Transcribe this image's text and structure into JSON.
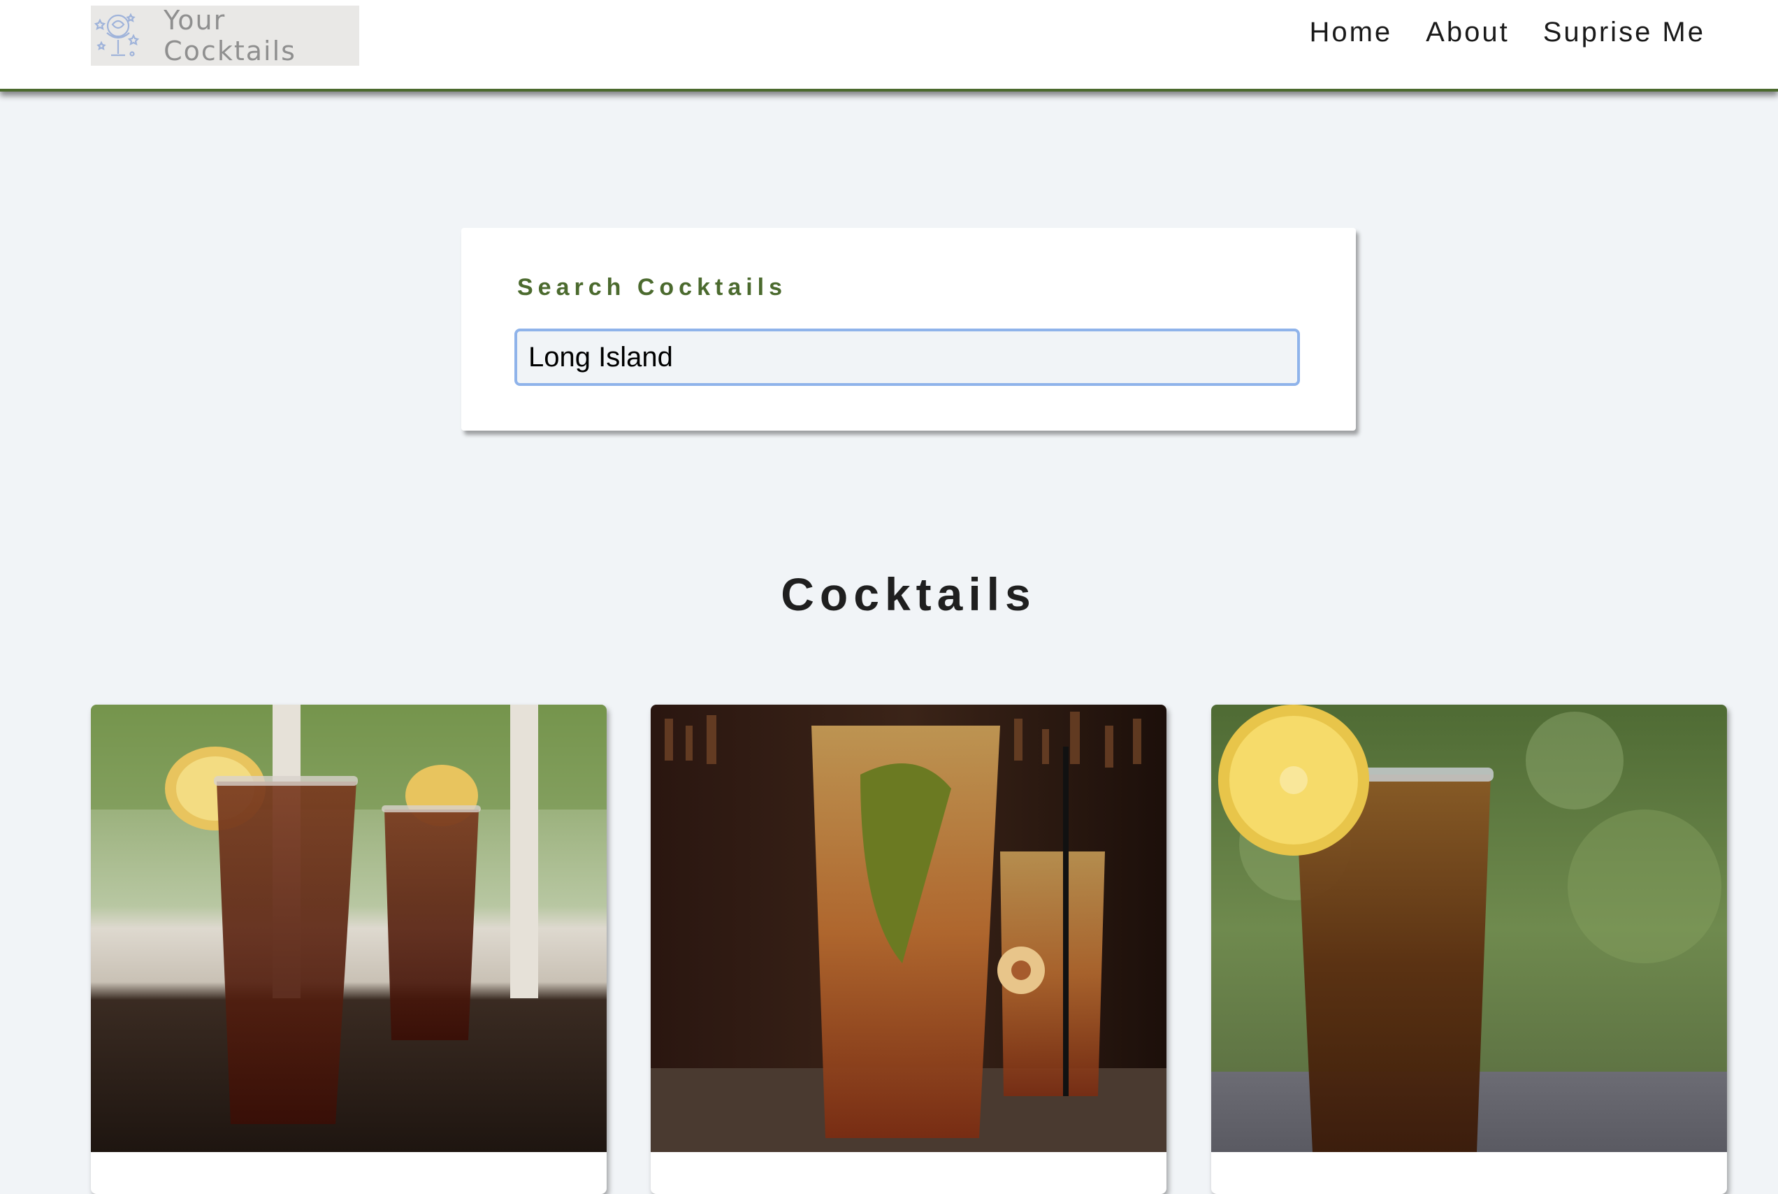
{
  "navbar": {
    "logo_text": "Your Cocktails",
    "logo_icon": "cocktail-glass-icon",
    "links": [
      "Home",
      "About",
      "Suprise Me"
    ]
  },
  "search": {
    "label": "Search Cocktails",
    "value": "Long Island"
  },
  "section": {
    "title": "Cocktails"
  },
  "cards": [
    {
      "image": "two-iced-teas-with-lemon-on-wooden-table-photo"
    },
    {
      "image": "long-island-iced-tea-at-bar-with-lime-photo"
    },
    {
      "image": "iced-tea-with-lemon-slice-green-background-photo"
    }
  ],
  "colors": {
    "accent_green": "#4b6a2e",
    "background": "#f1f4f7",
    "input_focus": "#8fb3ea"
  }
}
